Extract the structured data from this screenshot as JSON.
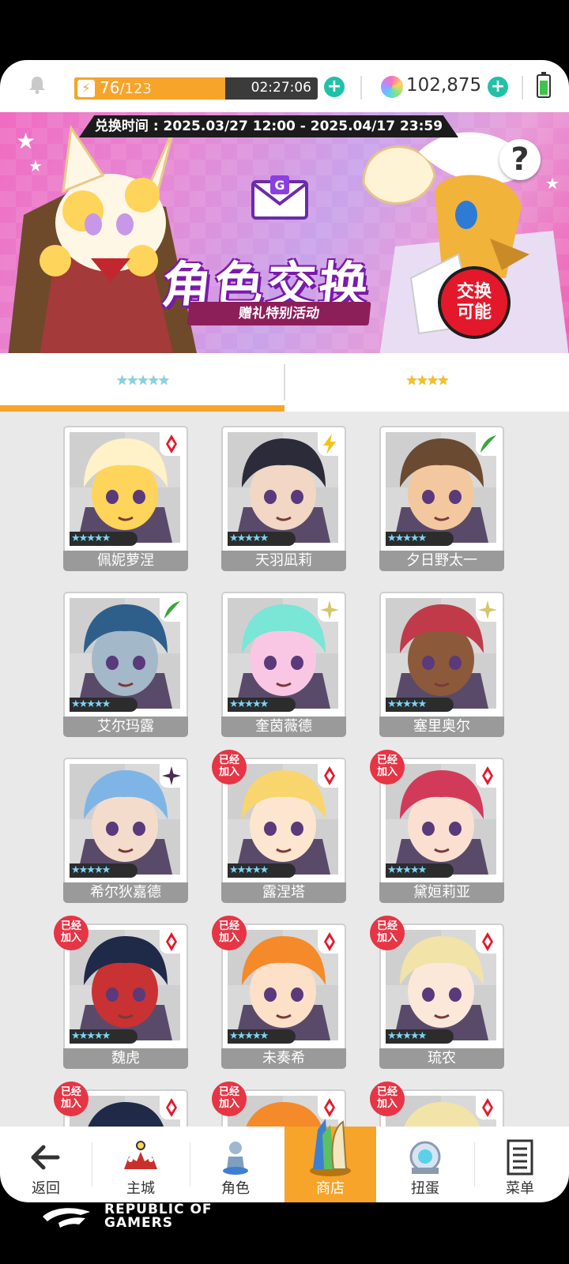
{
  "status": {
    "stamina_current": "76",
    "stamina_max": "/123",
    "stamina_fraction": 0.62,
    "timer": "02:27:06",
    "gems": "102,875",
    "bolt": "⚡",
    "plus": "+"
  },
  "banner": {
    "period": "兑换时间 : 2025.03/27 12:00 - 2025.04/17 23:59",
    "title": "角色交换",
    "subtitle": "赠礼特别活动",
    "badge": "交换\n可能",
    "help": "?"
  },
  "tabs": [
    {
      "stars": "★★★★★",
      "rarity": 5,
      "active": true
    },
    {
      "stars": "★★★★",
      "rarity": 4,
      "active": false
    }
  ],
  "characters": [
    {
      "name": "佩妮萝涅",
      "element": "fire",
      "joined": false,
      "stars": "★★★★★"
    },
    {
      "name": "天羽凪莉",
      "element": "thunder",
      "joined": false,
      "stars": "★★★★★"
    },
    {
      "name": "夕日野太一",
      "element": "wind",
      "joined": false,
      "stars": "★★★★★"
    },
    {
      "name": "艾尔玛露",
      "element": "wind",
      "joined": false,
      "stars": "★★★★★"
    },
    {
      "name": "奎茵薇德",
      "element": "light",
      "joined": false,
      "stars": "★★★★★"
    },
    {
      "name": "塞里奥尔",
      "element": "light",
      "joined": false,
      "stars": "★★★★★"
    },
    {
      "name": "希尔狄嘉德",
      "element": "dark",
      "joined": false,
      "stars": "★★★★★"
    },
    {
      "name": "露涅塔",
      "element": "fire",
      "joined": true,
      "stars": "★★★★★"
    },
    {
      "name": "黛姮莉亚",
      "element": "fire",
      "joined": true,
      "stars": "★★★★★"
    },
    {
      "name": "魏虎",
      "element": "fire",
      "joined": true,
      "stars": "★★★★★"
    },
    {
      "name": "未奏希",
      "element": "fire",
      "joined": true,
      "stars": "★★★★★"
    },
    {
      "name": "琉农",
      "element": "fire",
      "joined": true,
      "stars": "★★★★★"
    }
  ],
  "joined_label": "已经\n加入",
  "partial_row": [
    {
      "joined": true
    },
    {
      "joined": true
    },
    {
      "joined": true
    }
  ],
  "nav": [
    {
      "label": "返回",
      "icon": "back-arrow-icon",
      "active": false
    },
    {
      "label": "主城",
      "icon": "castle-icon",
      "active": false
    },
    {
      "label": "角色",
      "icon": "character-icon",
      "active": false
    },
    {
      "label": "商店",
      "icon": "shop-icon",
      "active": true
    },
    {
      "label": "扭蛋",
      "icon": "gacha-icon",
      "active": false
    },
    {
      "label": "菜单",
      "icon": "menu-list-icon",
      "active": false
    }
  ],
  "watermark": {
    "line1": "REPUBLIC OF",
    "line2": "GAMERS"
  },
  "colors": {
    "accent": "#f6a42a",
    "plus": "#21c1a8",
    "joined": "#e63545",
    "element_fire": "#e4182b",
    "element_thunder": "#f5c21a",
    "element_wind": "#3aa53a",
    "element_light": "#d4c76a",
    "element_dark": "#4a2b55"
  }
}
